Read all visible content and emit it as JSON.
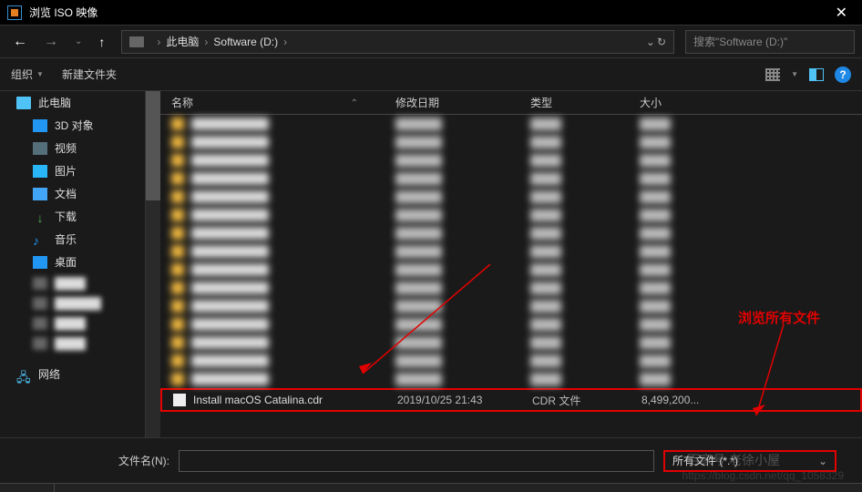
{
  "window": {
    "title": "浏览 ISO 映像"
  },
  "breadcrumb": {
    "root": "此电脑",
    "path": "Software (D:)"
  },
  "search": {
    "placeholder": "搜索\"Software (D:)\""
  },
  "toolbar": {
    "organize": "组织",
    "new_folder": "新建文件夹"
  },
  "sidebar": {
    "items": [
      {
        "label": "此电脑",
        "icon": "ico-pc",
        "level": 1
      },
      {
        "label": "3D 对象",
        "icon": "ico-3d",
        "level": 2
      },
      {
        "label": "视频",
        "icon": "ico-video",
        "level": 2
      },
      {
        "label": "图片",
        "icon": "ico-pic",
        "level": 2
      },
      {
        "label": "文档",
        "icon": "ico-doc",
        "level": 2
      },
      {
        "label": "下载",
        "icon": "ico-dl",
        "level": 2,
        "glyph": "↓"
      },
      {
        "label": "音乐",
        "icon": "ico-music",
        "level": 2,
        "glyph": "♪"
      },
      {
        "label": "桌面",
        "icon": "ico-desk",
        "level": 2
      }
    ],
    "blurred_count": 4,
    "network": {
      "label": "网络",
      "glyph": "🖧"
    }
  },
  "columns": {
    "name": "名称",
    "date": "修改日期",
    "type": "类型",
    "size": "大小"
  },
  "rows_blurred_count": 15,
  "highlighted_row": {
    "name": "Install macOS Catalina.cdr",
    "date": "2019/10/25 21:43",
    "type": "CDR 文件",
    "size": "8,499,200..."
  },
  "bottom": {
    "label": "文件名(N):",
    "type_filter": "所有文件 (*.*)"
  },
  "annotation": {
    "text": "浏览所有文件"
  },
  "watermark": {
    "main": "百家号 老徐小屋",
    "sub": "https://blog.csdn.net/qq_1058329"
  }
}
